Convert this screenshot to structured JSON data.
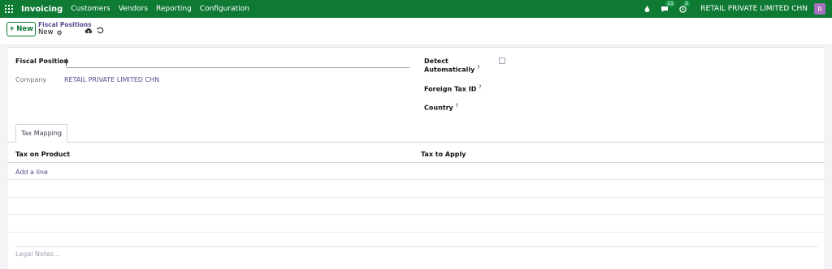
{
  "navbar": {
    "app_name": "Invoicing",
    "menu": [
      "Customers",
      "Vendors",
      "Reporting",
      "Configuration"
    ],
    "activity_count": "11",
    "updates_count": "2",
    "company": "RETAIL PRIVATE LIMITED CHN",
    "avatar_letter": "R",
    "accent_color": "#0e7a34"
  },
  "control_panel": {
    "new_label": "New",
    "breadcrumb_parent": "Fiscal Positions",
    "breadcrumb_current": "New"
  },
  "form": {
    "fiscal_position_label": "Fiscal Position",
    "fiscal_position_value": "",
    "company_label": "Company",
    "company_value": "RETAIL PRIVATE LIMITED CHN",
    "detect_label_1": "Detect",
    "detect_label_2": "Automatically",
    "detect_checked": false,
    "foreign_tax_label": "Foreign Tax ID",
    "country_label": "Country",
    "tooltip_mark": "?"
  },
  "tabs": [
    {
      "label": "Tax Mapping",
      "active": true
    }
  ],
  "tax_mapping": {
    "col_product": "Tax on Product",
    "col_apply": "Tax to Apply",
    "add_line": "Add a line"
  },
  "notes": {
    "placeholder": "Legal Notes..."
  }
}
